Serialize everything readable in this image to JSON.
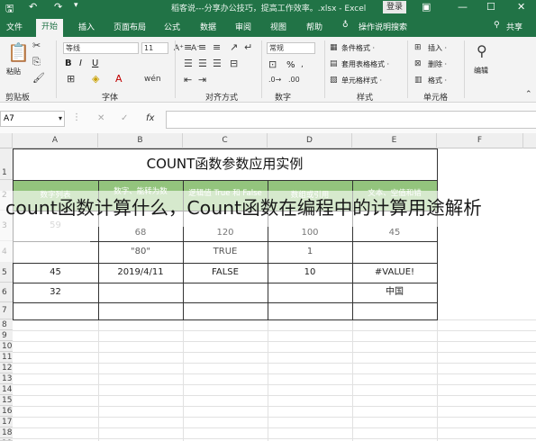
{
  "title_bar": {
    "title": "稻客说---分享办公技巧，提高工作效率。.xlsx - Excel",
    "login_label": "登录"
  },
  "tabs": [
    "文件",
    "开始",
    "插入",
    "页面布局",
    "公式",
    "数据",
    "审阅",
    "视图",
    "帮助"
  ],
  "active_tab": "开始",
  "tell_me": "操作说明搜索",
  "share": "共享",
  "ribbon": {
    "clipboard": {
      "paste_label": "粘贴",
      "group_label": "剪贴板"
    },
    "font": {
      "font_name": "等线",
      "font_size": "11",
      "bold": "B",
      "italic": "I",
      "underline": "U",
      "group_label": "字体"
    },
    "alignment": {
      "group_label": "对齐方式"
    },
    "number": {
      "format": "常规",
      "percent": "%",
      "group_label": "数字"
    },
    "styles": {
      "items": [
        "条件格式 ·",
        "套用表格格式 ·",
        "单元格样式 ·"
      ],
      "group_label": "样式"
    },
    "cells": {
      "items": [
        "插入 ·",
        "删除 ·",
        "格式 ·"
      ],
      "group_label": "单元格"
    },
    "editing": {
      "label": "编辑"
    }
  },
  "formula_bar": {
    "name_box": "A7",
    "fx": "fx"
  },
  "columns": [
    "A",
    "B",
    "C",
    "D",
    "E",
    "F"
  ],
  "rows": [
    "1",
    "2",
    "3",
    "4",
    "5",
    "6",
    "7",
    "8",
    "9",
    "10",
    "11",
    "12",
    "13",
    "14",
    "15",
    "16",
    "17",
    "18",
    "19"
  ],
  "sheet": {
    "title": "COUNT函数参数应用实例",
    "header": [
      "数字列表",
      "数字、能转为数",
      "逻辑值 True 和 False",
      "数组或引用",
      "文本、空值和错"
    ],
    "row3": [
      "59",
      "68",
      "120",
      "100",
      "45"
    ],
    "row4": [
      "",
      "\"80\"",
      "TRUE",
      "1",
      ""
    ],
    "row5": [
      "45",
      "2019/4/11",
      "FALSE",
      "10",
      "#VALUE!"
    ],
    "row6": [
      "32",
      "",
      "",
      "",
      "中国"
    ]
  },
  "overlay_caption": "count函数计算什么，Count函数在编程中的计算用途解析",
  "colors": {
    "excel_green": "#217346",
    "header_fill": "#93c47d"
  }
}
